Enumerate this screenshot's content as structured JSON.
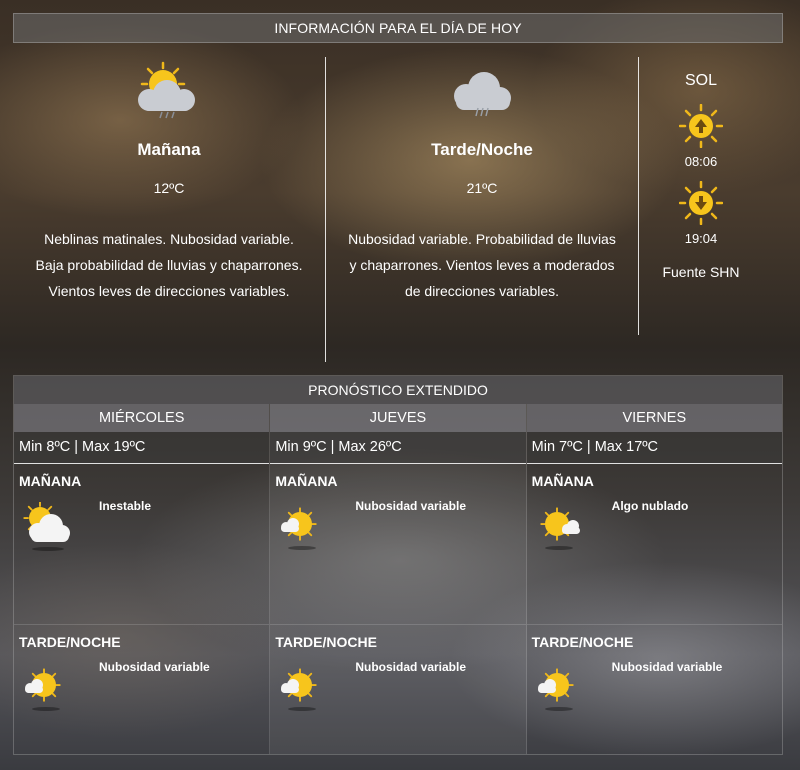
{
  "today": {
    "header": "INFORMACIÓN PARA EL DÍA DE HOY",
    "morning": {
      "title": "Mañana",
      "temp": "12ºC",
      "description": "Neblinas matinales. Nubosidad variable. Baja probabilidad de lluvias y chaparrones. Vientos leves de direcciones variables.",
      "icon": "sun-cloud-rain-icon"
    },
    "evening": {
      "title": "Tarde/Noche",
      "temp": "21ºC",
      "description": "Nubosidad variable. Probabilidad de lluvias y chaparrones. Vientos leves a moderados de direcciones variables.",
      "icon": "cloud-rain-icon"
    },
    "sun": {
      "title": "SOL",
      "sunrise": "08:06",
      "sunset": "19:04",
      "source": "Fuente SHN"
    }
  },
  "extended": {
    "header": "PRONÓSTICO EXTENDIDO",
    "days": [
      {
        "name": "MIÉRCOLES",
        "range": "Min 8ºC | Max 19ºC",
        "morning": {
          "label": "MAÑANA",
          "desc": "Inestable",
          "icon": "sun-behind-cloud-icon"
        },
        "evening": {
          "label": "TARDE/NOCHE",
          "desc": "Nubosidad variable",
          "icon": "sun-small-cloud-icon"
        }
      },
      {
        "name": "JUEVES",
        "range": "Min 9ºC | Max 26ºC",
        "morning": {
          "label": "MAÑANA",
          "desc": "Nubosidad variable",
          "icon": "sun-small-cloud-icon"
        },
        "evening": {
          "label": "TARDE/NOCHE",
          "desc": "Nubosidad variable",
          "icon": "sun-small-cloud-icon"
        }
      },
      {
        "name": "VIERNES",
        "range": "Min 7ºC | Max 17ºC",
        "morning": {
          "label": "MAÑANA",
          "desc": "Algo nublado",
          "icon": "sun-small-cloud-icon"
        },
        "evening": {
          "label": "TARDE/NOCHE",
          "desc": "Nubosidad variable",
          "icon": "sun-small-cloud-icon"
        }
      }
    ]
  },
  "colors": {
    "sun": "#f7c51c",
    "sun_ray": "#f0b81a",
    "cloud": "#f2f2f2",
    "rain_cloud": "#c9ccd2"
  }
}
